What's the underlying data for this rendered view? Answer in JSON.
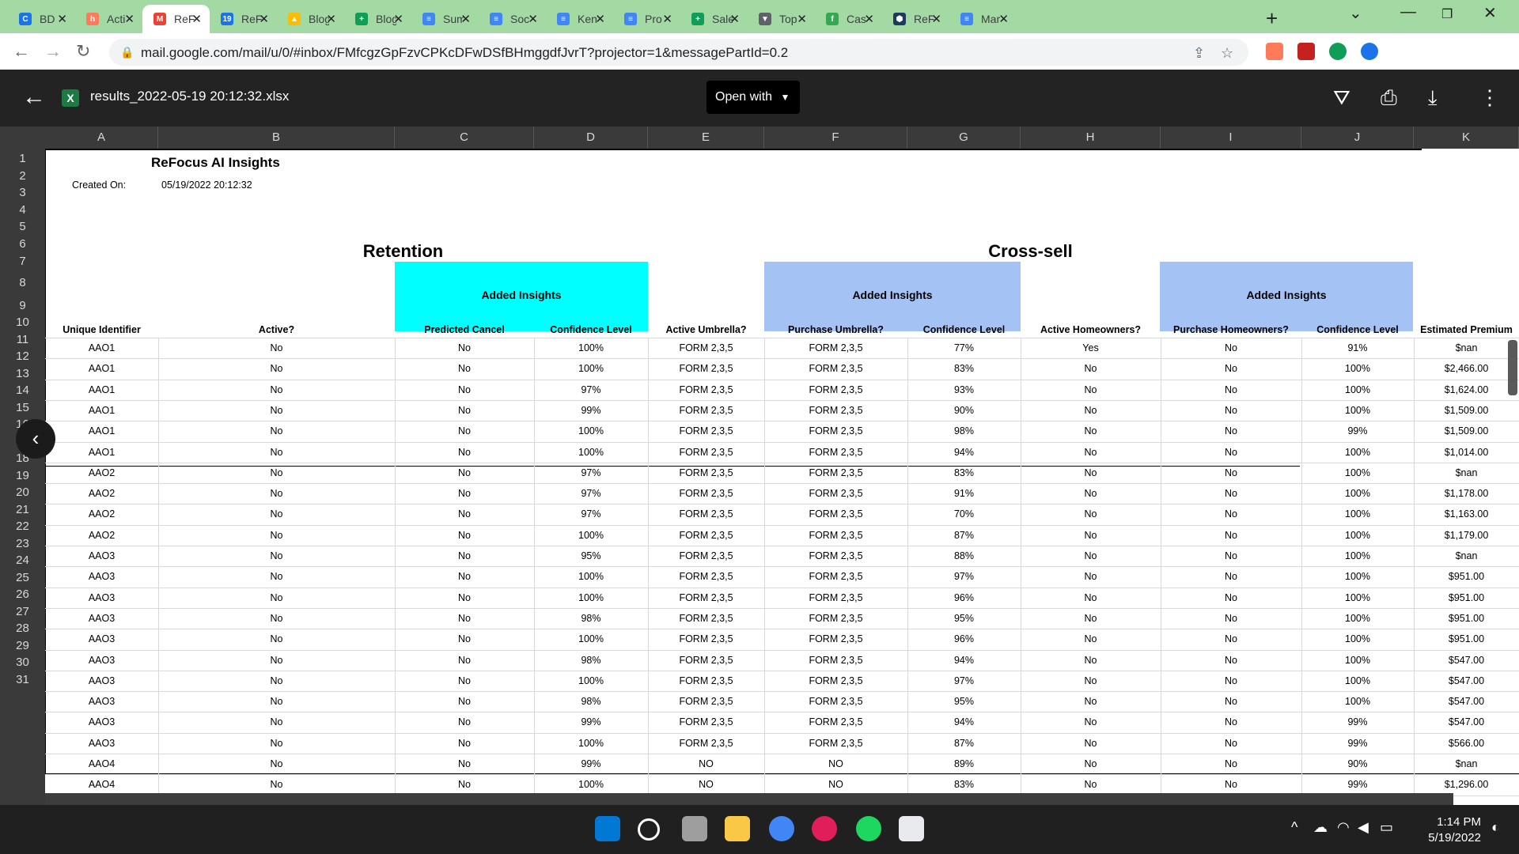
{
  "browser": {
    "tabs": [
      {
        "title": "BD",
        "color": "#1a73e8",
        "glyph": "C"
      },
      {
        "title": "Acti",
        "color": "#ff7a59",
        "glyph": "h"
      },
      {
        "title": "ReF",
        "color": "#ea4335",
        "glyph": "M",
        "active": true
      },
      {
        "title": "ReF",
        "color": "#1a73e8",
        "glyph": "19"
      },
      {
        "title": "Blog",
        "color": "#fbbc04",
        "glyph": "▲"
      },
      {
        "title": "Blog",
        "color": "#0f9d58",
        "glyph": "+"
      },
      {
        "title": "Sum",
        "color": "#4285f4",
        "glyph": "≡"
      },
      {
        "title": "Soc",
        "color": "#4285f4",
        "glyph": "≡"
      },
      {
        "title": "Ken",
        "color": "#4285f4",
        "glyph": "≡"
      },
      {
        "title": "Pro",
        "color": "#4285f4",
        "glyph": "≡"
      },
      {
        "title": "Sale",
        "color": "#0f9d58",
        "glyph": "+"
      },
      {
        "title": "Top",
        "color": "#5f6368",
        "glyph": "▼"
      },
      {
        "title": "Cas",
        "color": "#34a853",
        "glyph": "f"
      },
      {
        "title": "ReF",
        "color": "#1b3a5c",
        "glyph": "⬢"
      },
      {
        "title": "Mar",
        "color": "#4285f4",
        "glyph": "≡"
      }
    ],
    "url": "mail.google.com/mail/u/0/#inbox/FMfcgzGpFzvCPKcDFwDSfBHmggdfJvrT?projector=1&messagePartId=0.2"
  },
  "viewer": {
    "filename": "results_2022-05-19 20:12:32.xlsx",
    "open_with": "Open with"
  },
  "sheet": {
    "columns": [
      "A",
      "B",
      "C",
      "D",
      "E",
      "F",
      "G",
      "H",
      "I",
      "J",
      "K"
    ],
    "row_numbers": [
      "1",
      "2",
      "3",
      "4",
      "5",
      "6",
      "7",
      "8",
      "9",
      "10",
      "11",
      "12",
      "13",
      "14",
      "15",
      "16",
      "17",
      "18",
      "19",
      "20",
      "21",
      "22",
      "23",
      "24",
      "25",
      "26",
      "27",
      "28",
      "29",
      "30",
      "31"
    ],
    "title": "ReFocus AI Insights",
    "created_label": "Created On:",
    "created_value": "05/19/2022 20:12:32",
    "section_retention": "Retention",
    "section_crosssell": "Cross-sell",
    "added_insights": "Added Insights",
    "headers": [
      "Unique Identifier",
      "Active?",
      "Predicted Cancel",
      "Confidence Level",
      "Active Umbrella?",
      "Purchase Umbrella?",
      "Confidence Level",
      "Active Homeowners?",
      "Purchase Homeowners?",
      "Confidence Level",
      "Estimated Premium"
    ],
    "rows": [
      [
        "AAO1",
        "No",
        "No",
        "100%",
        "FORM 2,3,5",
        "FORM 2,3,5",
        "77%",
        "Yes",
        "No",
        "91%",
        "$nan"
      ],
      [
        "AAO1",
        "No",
        "No",
        "100%",
        "FORM 2,3,5",
        "FORM 2,3,5",
        "83%",
        "No",
        "No",
        "100%",
        "$2,466.00"
      ],
      [
        "AAO1",
        "No",
        "No",
        "97%",
        "FORM 2,3,5",
        "FORM 2,3,5",
        "93%",
        "No",
        "No",
        "100%",
        "$1,624.00"
      ],
      [
        "AAO1",
        "No",
        "No",
        "99%",
        "FORM 2,3,5",
        "FORM 2,3,5",
        "90%",
        "No",
        "No",
        "100%",
        "$1,509.00"
      ],
      [
        "AAO1",
        "No",
        "No",
        "100%",
        "FORM 2,3,5",
        "FORM 2,3,5",
        "98%",
        "No",
        "No",
        "99%",
        "$1,509.00"
      ],
      [
        "AAO1",
        "No",
        "No",
        "100%",
        "FORM 2,3,5",
        "FORM 2,3,5",
        "94%",
        "No",
        "No",
        "100%",
        "$1,014.00"
      ],
      [
        "AAO2",
        "No",
        "No",
        "97%",
        "FORM 2,3,5",
        "FORM 2,3,5",
        "83%",
        "No",
        "No",
        "100%",
        "$nan"
      ],
      [
        "AAO2",
        "No",
        "No",
        "97%",
        "FORM 2,3,5",
        "FORM 2,3,5",
        "91%",
        "No",
        "No",
        "100%",
        "$1,178.00"
      ],
      [
        "AAO2",
        "No",
        "No",
        "97%",
        "FORM 2,3,5",
        "FORM 2,3,5",
        "70%",
        "No",
        "No",
        "100%",
        "$1,163.00"
      ],
      [
        "AAO2",
        "No",
        "No",
        "100%",
        "FORM 2,3,5",
        "FORM 2,3,5",
        "87%",
        "No",
        "No",
        "100%",
        "$1,179.00"
      ],
      [
        "AAO3",
        "No",
        "No",
        "95%",
        "FORM 2,3,5",
        "FORM 2,3,5",
        "88%",
        "No",
        "No",
        "100%",
        "$nan"
      ],
      [
        "AAO3",
        "No",
        "No",
        "100%",
        "FORM 2,3,5",
        "FORM 2,3,5",
        "97%",
        "No",
        "No",
        "100%",
        "$951.00"
      ],
      [
        "AAO3",
        "No",
        "No",
        "100%",
        "FORM 2,3,5",
        "FORM 2,3,5",
        "96%",
        "No",
        "No",
        "100%",
        "$951.00"
      ],
      [
        "AAO3",
        "No",
        "No",
        "98%",
        "FORM 2,3,5",
        "FORM 2,3,5",
        "95%",
        "No",
        "No",
        "100%",
        "$951.00"
      ],
      [
        "AAO3",
        "No",
        "No",
        "100%",
        "FORM 2,3,5",
        "FORM 2,3,5",
        "96%",
        "No",
        "No",
        "100%",
        "$951.00"
      ],
      [
        "AAO3",
        "No",
        "No",
        "98%",
        "FORM 2,3,5",
        "FORM 2,3,5",
        "94%",
        "No",
        "No",
        "100%",
        "$547.00"
      ],
      [
        "AAO3",
        "No",
        "No",
        "100%",
        "FORM 2,3,5",
        "FORM 2,3,5",
        "97%",
        "No",
        "No",
        "100%",
        "$547.00"
      ],
      [
        "AAO3",
        "No",
        "No",
        "98%",
        "FORM 2,3,5",
        "FORM 2,3,5",
        "95%",
        "No",
        "No",
        "100%",
        "$547.00"
      ],
      [
        "AAO3",
        "No",
        "No",
        "99%",
        "FORM 2,3,5",
        "FORM 2,3,5",
        "94%",
        "No",
        "No",
        "99%",
        "$547.00"
      ],
      [
        "AAO3",
        "No",
        "No",
        "100%",
        "FORM 2,3,5",
        "FORM 2,3,5",
        "87%",
        "No",
        "No",
        "99%",
        "$566.00"
      ],
      [
        "AAO4",
        "No",
        "No",
        "99%",
        "NO",
        "NO",
        "89%",
        "No",
        "No",
        "90%",
        "$nan"
      ],
      [
        "AAO4",
        "No",
        "No",
        "100%",
        "NO",
        "NO",
        "83%",
        "No",
        "No",
        "99%",
        "$1,296.00"
      ]
    ]
  },
  "taskbar": {
    "time": "1:14 PM",
    "date": "5/19/2022"
  }
}
